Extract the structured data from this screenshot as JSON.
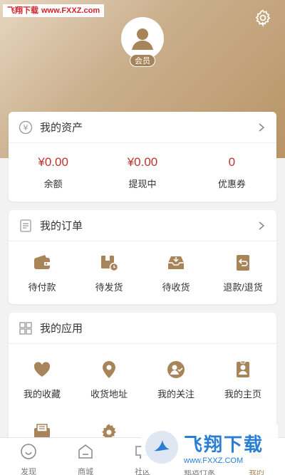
{
  "watermark": {
    "brand": "飞翔下载",
    "url": "www.FXXZ.com",
    "brand_large": "飞翔下载",
    "url_large": "www.FXXZ.COM"
  },
  "header": {
    "member_badge": "会员",
    "icons": {
      "settings": "gear-icon",
      "avatar": "user-avatar-icon"
    }
  },
  "colors": {
    "accent": "#a8845a",
    "price": "#c0312d",
    "header_gradient_start": "#e6d6c0",
    "header_gradient_end": "#b89466"
  },
  "assets": {
    "title": "我的资产",
    "icon": "yen-coin-icon",
    "items": [
      {
        "value": "¥0.00",
        "label": "余额"
      },
      {
        "value": "¥0.00",
        "label": "提现中"
      },
      {
        "value": "0",
        "label": "优惠券"
      }
    ]
  },
  "orders": {
    "title": "我的订单",
    "icon": "document-list-icon",
    "items": [
      {
        "label": "待付款",
        "icon": "wallet-icon"
      },
      {
        "label": "待发货",
        "icon": "package-clock-icon"
      },
      {
        "label": "待收货",
        "icon": "inbox-receive-icon"
      },
      {
        "label": "退款/退货",
        "icon": "return-icon"
      }
    ]
  },
  "apps": {
    "title": "我的应用",
    "icon": "grid-icon",
    "items": [
      {
        "label": "我的收藏",
        "icon": "heart-icon"
      },
      {
        "label": "收货地址",
        "icon": "location-pin-icon"
      },
      {
        "label": "我的关注",
        "icon": "follow-user-icon"
      },
      {
        "label": "我的主页",
        "icon": "profile-card-icon"
      },
      {
        "label": "",
        "icon": "mail-icon"
      },
      {
        "label": "",
        "icon": "gear-icon"
      }
    ]
  },
  "tabbar": [
    {
      "label": "发现",
      "icon": "discover-icon"
    },
    {
      "label": "商城",
      "icon": "shop-icon"
    },
    {
      "label": "社区",
      "icon": "community-icon"
    },
    {
      "label": "甄选行家",
      "icon": "expert-icon"
    },
    {
      "label": "我的",
      "icon": "me-icon",
      "active": true
    }
  ]
}
